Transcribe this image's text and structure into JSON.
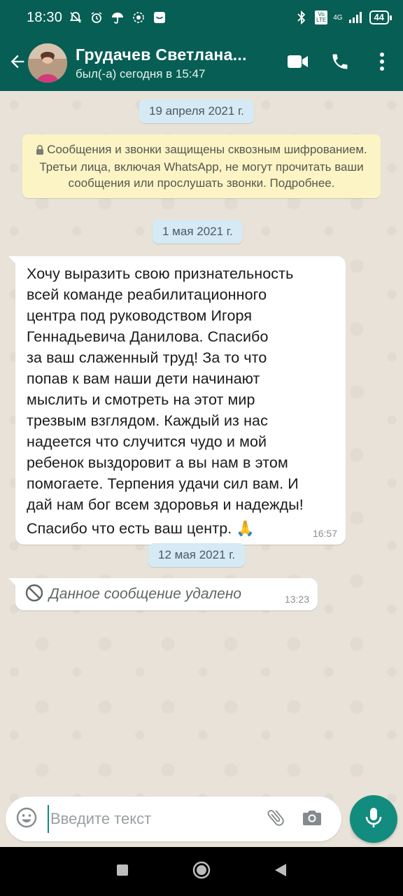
{
  "status_bar": {
    "time": "18:30",
    "network_label": "4G",
    "volte_label": "Vo LTE",
    "battery": "44",
    "icons": [
      "mute-icon",
      "alarm-icon",
      "umbrella-icon",
      "accessibility-icon",
      "app-notification-icon",
      "bluetooth-icon",
      "volte-icon",
      "signal-icon",
      "battery-icon"
    ]
  },
  "header": {
    "contact_name": "Грудачев Светлана...",
    "last_seen": "был(-а) сегодня в 15:47",
    "icons": [
      "back-arrow-icon",
      "video-call-icon",
      "phone-icon",
      "more-vert-icon"
    ]
  },
  "chat": {
    "date1": "19 апреля 2021 г.",
    "encryption_notice": "Сообщения и звонки защищены сквозным шифрованием. Третьи лица, включая WhatsApp, не могут прочитать ваши сообщения или прослушать звонки. Подробнее.",
    "date2": "1 мая 2021 г.",
    "message1": {
      "lines": [
        "Хочу выразить свою признательность",
        "всей команде реабилитационного",
        "центра под руководством Игоря",
        "Геннадьевича Данилова. Спасибо",
        "за ваш слаженный труд! За то что",
        "попав к вам наши дети начинают",
        "мыслить и смотреть на этот мир",
        "трезвым взглядом. Каждый из нас",
        "надеется что случится чудо и мой",
        "ребенок выздоровит а вы нам в этом",
        "помогаете. Терпения удачи сил вам. И",
        "дай нам бог всем здоровья и надежды!",
        "Спасибо что есть ваш центр. 🙏"
      ],
      "time": "16:57"
    },
    "date3": "12 мая 2021 г.",
    "message2": {
      "text": "Данное сообщение удалено",
      "time": "13:23"
    }
  },
  "composer": {
    "placeholder": "Введите текст"
  },
  "colors": {
    "header": "#075e54",
    "accent": "#128c7e",
    "notice_bg": "#fdf4c5",
    "date_bg": "#d5eaf4"
  }
}
